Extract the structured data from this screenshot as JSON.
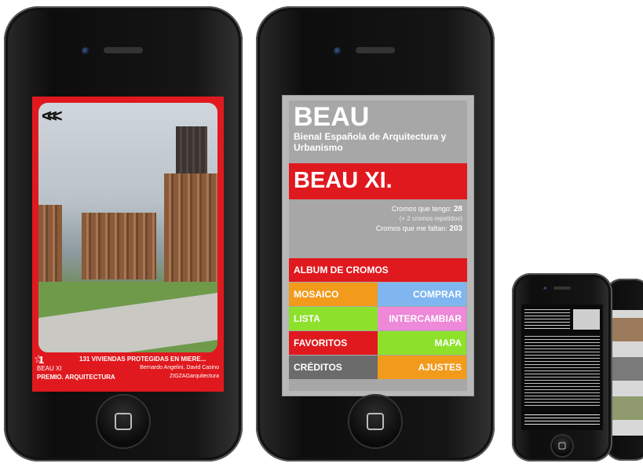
{
  "card": {
    "back_icon": "triple-chevron-left-icon",
    "number": "1",
    "title": "131 VIVIENDAS PROTEGIDAS EN MIERE...",
    "edition": "BEAU XI",
    "authors": "Bernardo Angelini, David Casino",
    "award": "PREMIO. ARQUITECTURA",
    "studio": "ZIGZAGarquitectura"
  },
  "menu_screen": {
    "title": "BEAU",
    "subtitle": "Bienal Española de Arquitectura y Urbanismo",
    "band_title": "BEAU XI.",
    "stats": {
      "have_label": "Cromos que tengo:",
      "have_value": "28",
      "repeated": "(+ 2 cromos repetidos)",
      "missing_label": "Cromos que me faltan:",
      "missing_value": "203"
    },
    "buttons": {
      "album": "ALBUM DE CROMOS",
      "mosaico": "MOSAICO",
      "comprar": "COMPRAR",
      "lista": "LISTA",
      "intercambiar": "INTERCAMBIAR",
      "favoritos": "FAVORITOS",
      "mapa": "MAPA",
      "creditos": "CRÉDITOS",
      "ajustes": "AJUSTES"
    },
    "colors": {
      "album": "#e0191f",
      "mosaico": "#f29a1c",
      "comprar": "#7fb6f0",
      "lista": "#8de12b",
      "intercambiar": "#ee88d8",
      "favoritos": "#e0191f",
      "mapa": "#8de12b",
      "creditos": "#6b6b6b",
      "ajustes": "#f29a1c"
    }
  }
}
